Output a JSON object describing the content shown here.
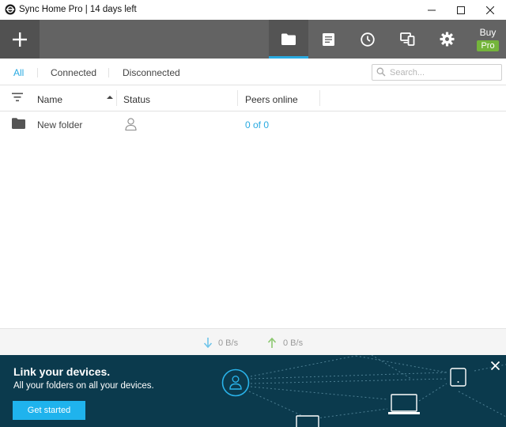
{
  "window": {
    "title": "Sync Home Pro | 14 days left",
    "logo_icon": "sync-logo-icon",
    "controls": [
      "minimize-icon",
      "maximize-icon",
      "close-icon"
    ]
  },
  "toolbar": {
    "add_icon": "plus-icon",
    "buttons": [
      {
        "icon": "folder-icon",
        "active": true
      },
      {
        "icon": "document-icon",
        "active": false
      },
      {
        "icon": "clock-icon",
        "active": false
      },
      {
        "icon": "devices-icon",
        "active": false
      },
      {
        "icon": "gear-icon",
        "active": false
      }
    ],
    "buy_label": "Buy",
    "pro_badge": "Pro",
    "accent_color": "#29aae1",
    "pro_color": "#74b53b"
  },
  "filters": {
    "tabs": [
      {
        "label": "All",
        "active": true
      },
      {
        "label": "Connected",
        "active": false
      },
      {
        "label": "Disconnected",
        "active": false
      }
    ],
    "search_placeholder": "Search..."
  },
  "table": {
    "columns": {
      "name": "Name",
      "status": "Status",
      "peers": "Peers online"
    },
    "sort": "name-ascending",
    "rows": [
      {
        "name": "New folder",
        "status_icon": "person-icon",
        "peers": "0 of 0"
      }
    ]
  },
  "speed": {
    "download": "0 B/s",
    "upload": "0 B/s"
  },
  "banner": {
    "title": "Link your devices.",
    "subtitle": "All your folders on all your devices.",
    "button": "Get started",
    "background": "#0b3a4d",
    "button_color": "#1fb3ed"
  }
}
